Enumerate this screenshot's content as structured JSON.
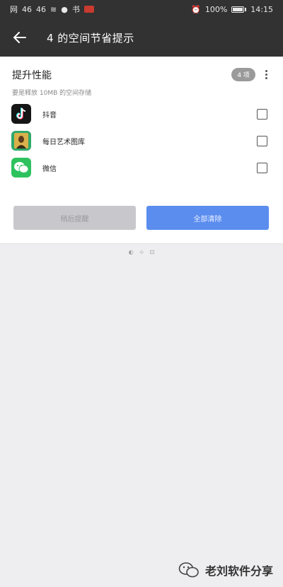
{
  "status_bar": {
    "left_items": [
      "网",
      "46",
      "46",
      "≋",
      "●",
      "书",
      "抖"
    ],
    "alarm": "⏰",
    "battery_level": 1.0,
    "battery_label": "100%",
    "time": "14:15"
  },
  "app_bar": {
    "title": "4 的空间节省提示"
  },
  "section": {
    "title": "提升性能",
    "subtitle": "要是释放 10MB 的空间存储",
    "count_badge": "4 项"
  },
  "apps": [
    {
      "name": "抖音",
      "icon": "tiktok-icon",
      "checked": false
    },
    {
      "name": "每日艺术图库",
      "icon": "art-app-icon",
      "checked": false
    },
    {
      "name": "微信",
      "icon": "wechat-icon",
      "checked": false
    }
  ],
  "buttons": {
    "cancel_label": "稍后提醒",
    "confirm_label": "全部清除"
  },
  "footer": {
    "icons": [
      "◐",
      "⊹",
      "⊡"
    ]
  },
  "watermark": {
    "text": "老刘软件分享"
  },
  "colors": {
    "bar": "#323232",
    "accent": "#5b8def",
    "disabled": "#c8c8cc"
  }
}
